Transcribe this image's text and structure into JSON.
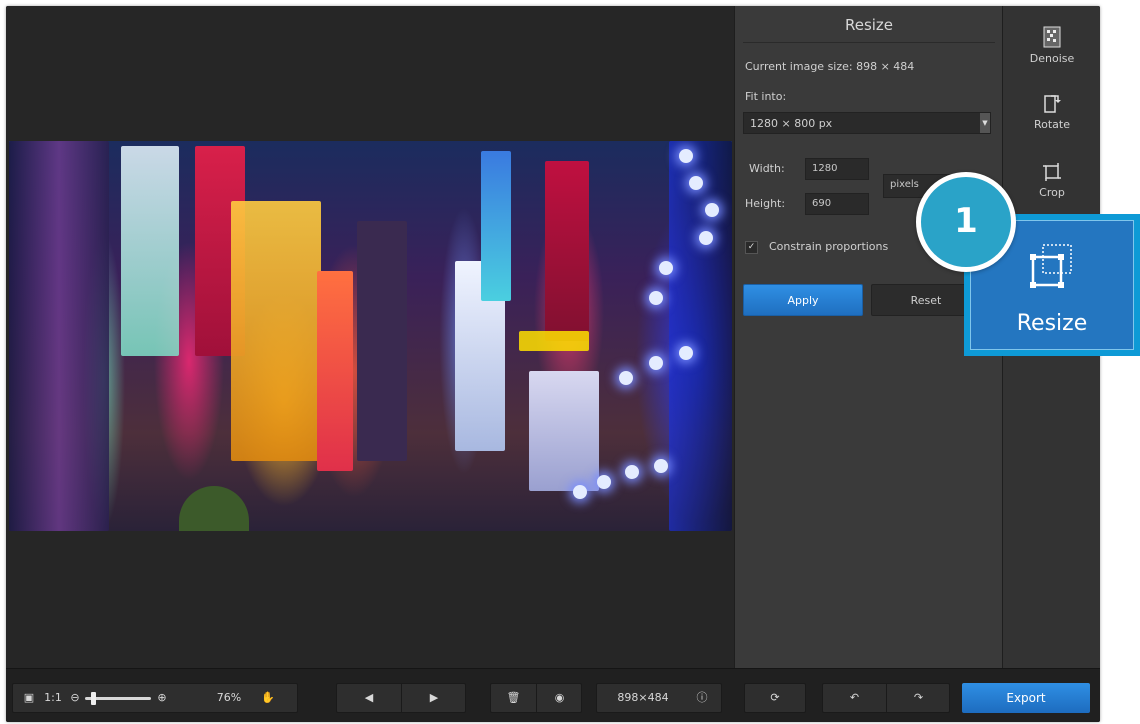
{
  "panel": {
    "title": "Resize",
    "current_size": "Current image size: 898 × 484",
    "fit_into_label": "Fit into:",
    "fit_into_value": "1280 × 800 px",
    "width_label": "Width:",
    "width_value": "1280",
    "height_label": "Height:",
    "height_value": "690",
    "unit_value": "pixels",
    "constrain_label": "Constrain proportions",
    "apply_label": "Apply",
    "reset_label": "Reset"
  },
  "tools": {
    "denoise": "Denoise",
    "rotate": "Rotate",
    "crop": "Crop",
    "resize": "Resize"
  },
  "callout": {
    "number": "1",
    "label": "Resize"
  },
  "bottom": {
    "one_to_one": "1:1",
    "zoom": "76%",
    "dimensions": "898×484",
    "export": "Export"
  },
  "colors": {
    "accent": "#2a8ce0",
    "callout": "#0e9ad6",
    "panel": "#3a3a3a"
  },
  "icons": [
    "fit-screen-icon",
    "zoom-out-icon",
    "zoom-in-icon",
    "hand-icon",
    "prev-icon",
    "next-icon",
    "trash-icon",
    "eye-icon",
    "info-icon",
    "rotate-icon",
    "undo-icon",
    "redo-icon",
    "denoise-icon",
    "rotate-tool-icon",
    "crop-icon",
    "resize-icon"
  ]
}
